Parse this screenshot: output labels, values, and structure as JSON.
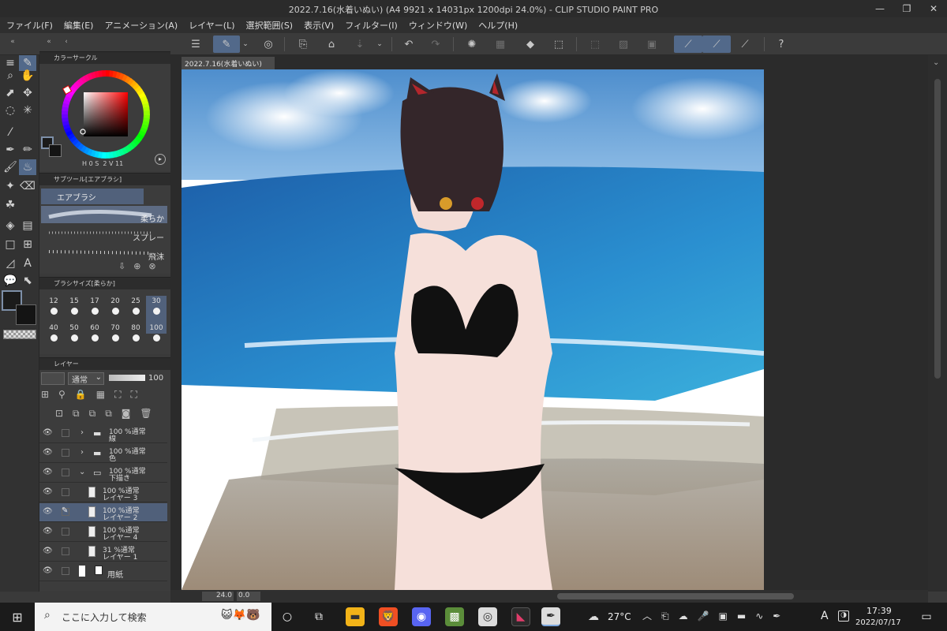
{
  "window": {
    "title": "2022.7.16(水着いぬい) (A4 9921 x 14031px 1200dpi 24.0%) - CLIP STUDIO PAINT PRO"
  },
  "menu": [
    "ファイル(F)",
    "編集(E)",
    "アニメーション(A)",
    "レイヤー(L)",
    "選択範囲(S)",
    "表示(V)",
    "フィルター(I)",
    "ウィンドウ(W)",
    "ヘルプ(H)"
  ],
  "color_circle": {
    "title": "カラーサークル",
    "readout": {
      "h": "H",
      "h_val": "0",
      "s": "S",
      "s_val": "2",
      "v": "V",
      "v_val": "11"
    }
  },
  "subtool": {
    "title": "サブツール[エアブラシ]",
    "group": "エアブラシ",
    "items": [
      "柔らか",
      "スプレー",
      "飛沫"
    ]
  },
  "brush_size": {
    "title": "ブラシサイズ[柔らか]",
    "row1": [
      "12",
      "15",
      "17",
      "20",
      "25",
      "30"
    ],
    "row2": [
      "40",
      "50",
      "60",
      "70",
      "80",
      "100"
    ],
    "selected": "30"
  },
  "layer_panel": {
    "title": "レイヤー",
    "blend_mode": "通常",
    "opacity": "100",
    "layers": [
      {
        "pct": "100 %通常",
        "name": "線",
        "type": "folder"
      },
      {
        "pct": "100 %通常",
        "name": "色",
        "type": "folder"
      },
      {
        "pct": "100 %通常",
        "name": "下描き",
        "type": "folder-open"
      },
      {
        "pct": "100 %通常",
        "name": "レイヤー 3",
        "type": "raster"
      },
      {
        "pct": "100 %通常",
        "name": "レイヤー 2",
        "type": "raster",
        "selected": true
      },
      {
        "pct": "100 %通常",
        "name": "レイヤー 4",
        "type": "raster"
      },
      {
        "pct": "31 %通常",
        "name": "レイヤー 1",
        "type": "raster"
      },
      {
        "pct": "",
        "name": "用紙",
        "type": "paper"
      }
    ]
  },
  "canvas": {
    "tab_label": "2022.7.16(水着いぬい)",
    "zoom": "24.0",
    "angle": "0.0"
  },
  "taskbar": {
    "search_placeholder": "ここに入力して検索",
    "weather": "27°C",
    "time": "17:39",
    "date": "2022/07/17",
    "ime": "A"
  },
  "colors": {
    "accent": "#52698a",
    "main_color": "#1b1b1b",
    "sub_color": "#141414"
  }
}
